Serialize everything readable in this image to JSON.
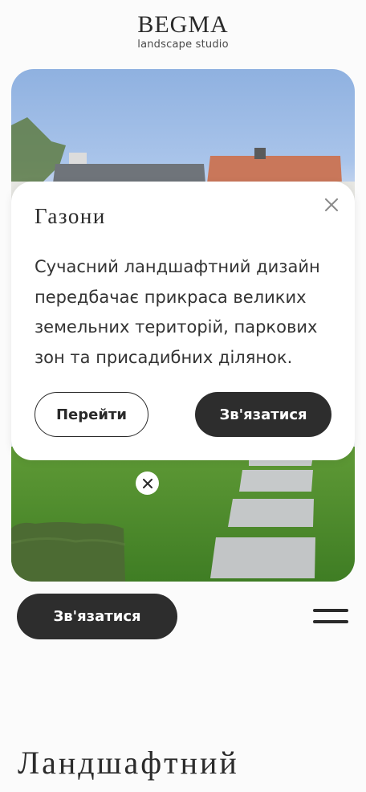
{
  "header": {
    "logo_title": "BEGMA",
    "logo_subtitle": "landscape studio"
  },
  "modal": {
    "title": "Газони",
    "text": "Сучасний ландшафтний дизайн передбачає прикраса великих земельних територій, паркових зон та присадибних ділянок.",
    "secondary_button": "Перейти",
    "primary_button": "Зв'язатися",
    "close_icon": "close-icon"
  },
  "hero": {
    "marker_icon": "close-icon"
  },
  "bottom_bar": {
    "contact_button": "Зв'язатися",
    "menu_icon": "hamburger-menu-icon"
  },
  "section": {
    "heading": "Ландшафтний"
  },
  "colors": {
    "dark": "#2d2d2d",
    "grass": "#4f8c2e",
    "sky": "#9dbbe6"
  }
}
